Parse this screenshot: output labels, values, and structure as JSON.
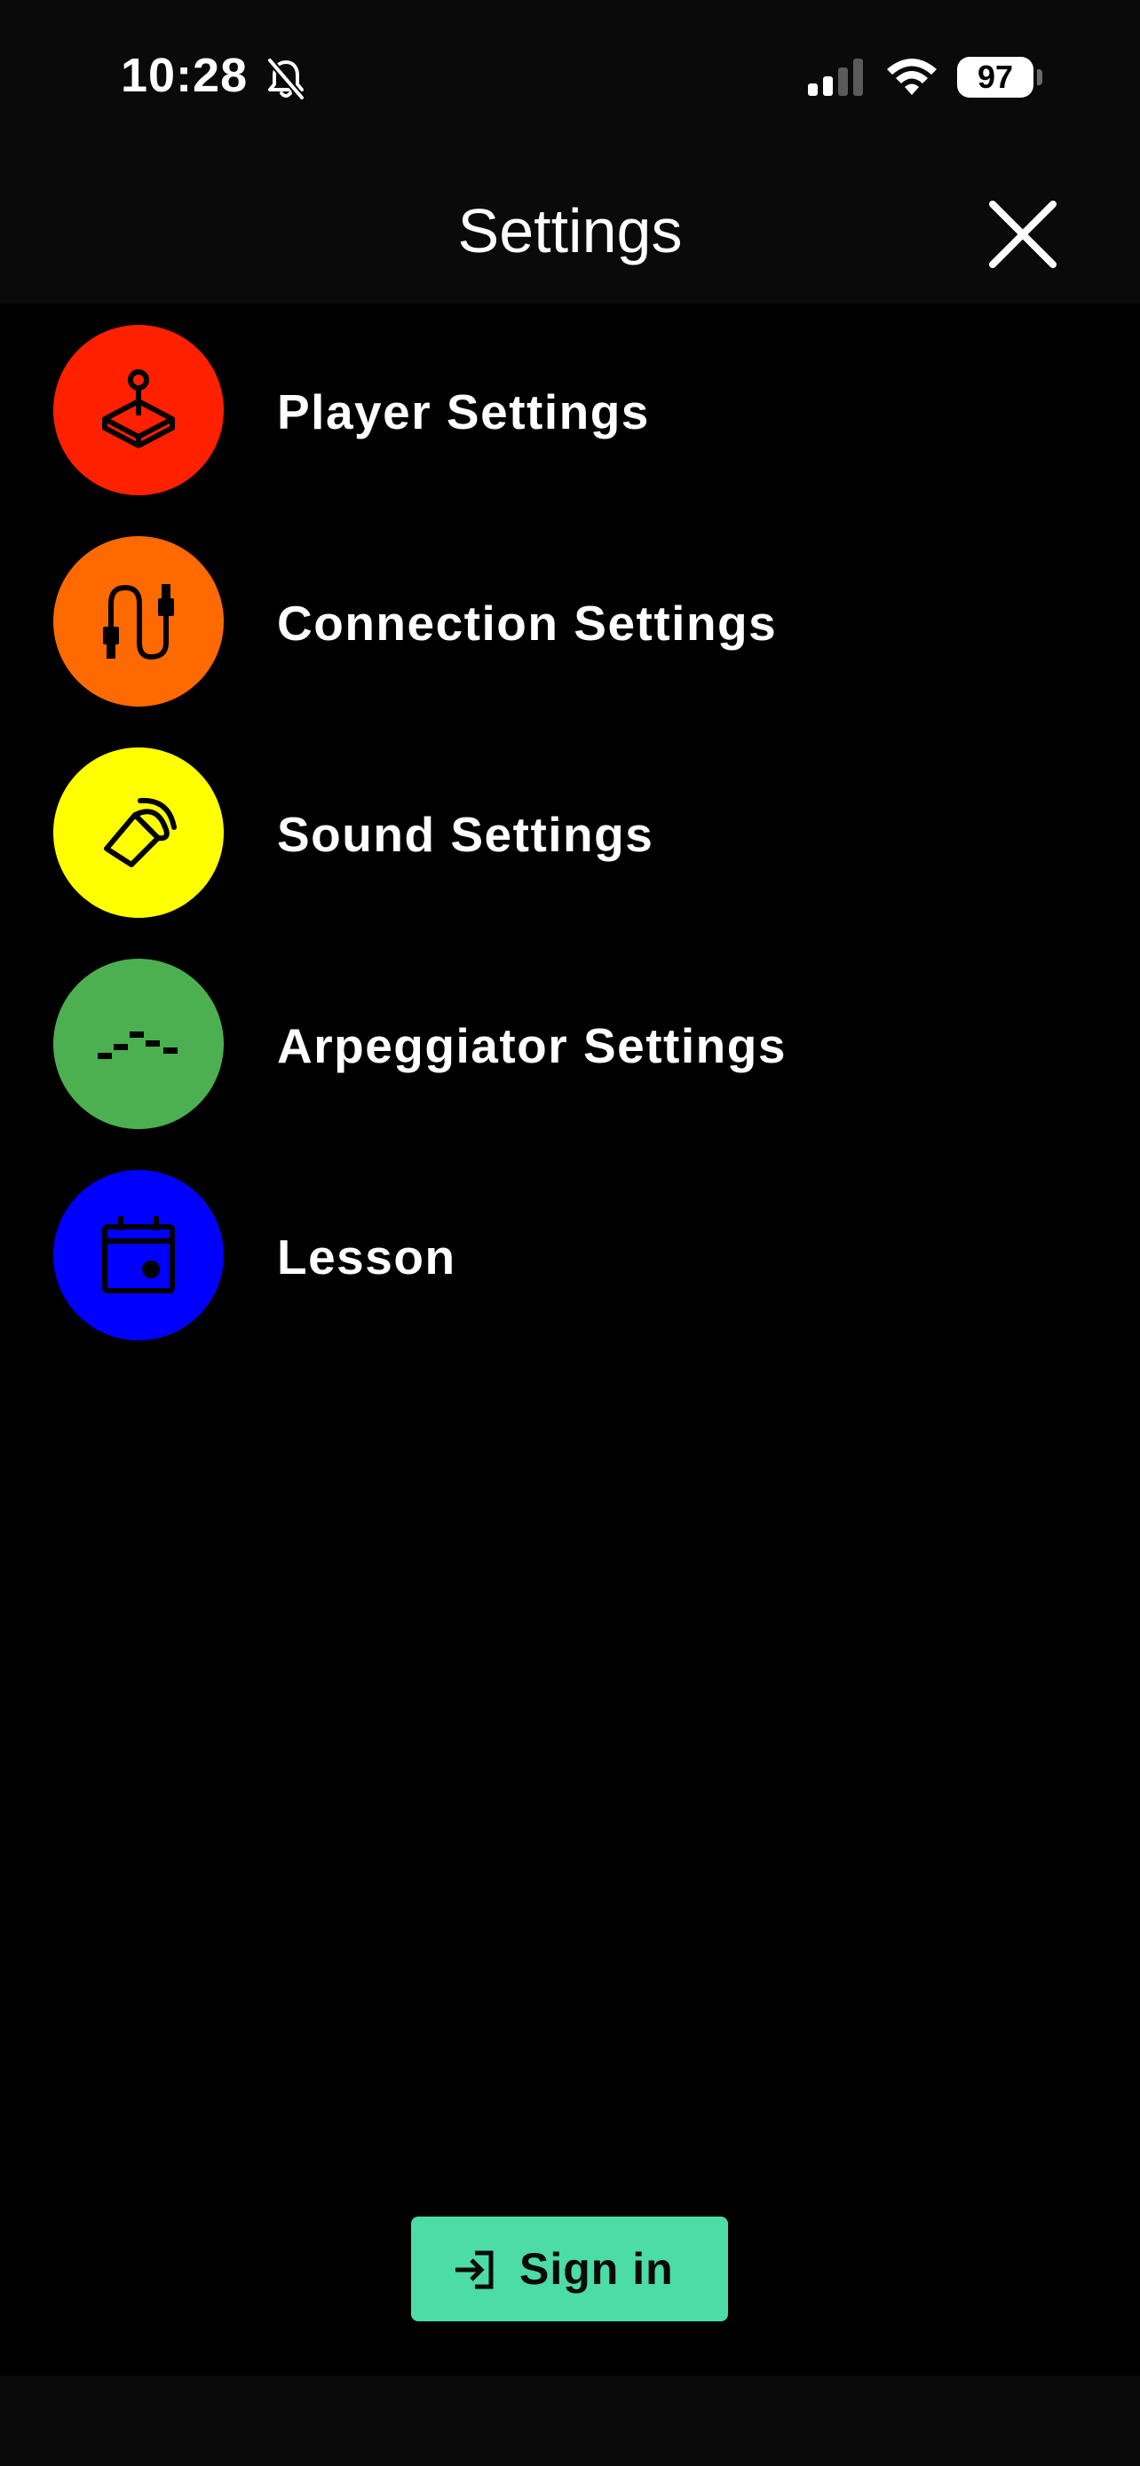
{
  "status_bar": {
    "time": "10:28",
    "battery": "97",
    "icons": [
      "bell-slash-icon",
      "signal-icon",
      "wifi-icon",
      "battery-icon"
    ]
  },
  "header": {
    "title": "Settings",
    "close_icon": "close-icon"
  },
  "menu": {
    "items": [
      {
        "label": "Player Settings",
        "icon": "joystick-icon",
        "color": "#ff2000"
      },
      {
        "label": "Connection Settings",
        "icon": "cable-icon",
        "color": "#ff6a00"
      },
      {
        "label": "Sound Settings",
        "icon": "speaker-icon",
        "color": "#ffff00"
      },
      {
        "label": "Arpeggiator Settings",
        "icon": "arpeggio-icon",
        "color": "#4caf50"
      },
      {
        "label": "Lesson",
        "icon": "calendar-icon",
        "color": "#0000ff"
      }
    ]
  },
  "signin": {
    "label": "Sign in",
    "icon": "sign-in-icon",
    "color": "#4cdca6"
  }
}
